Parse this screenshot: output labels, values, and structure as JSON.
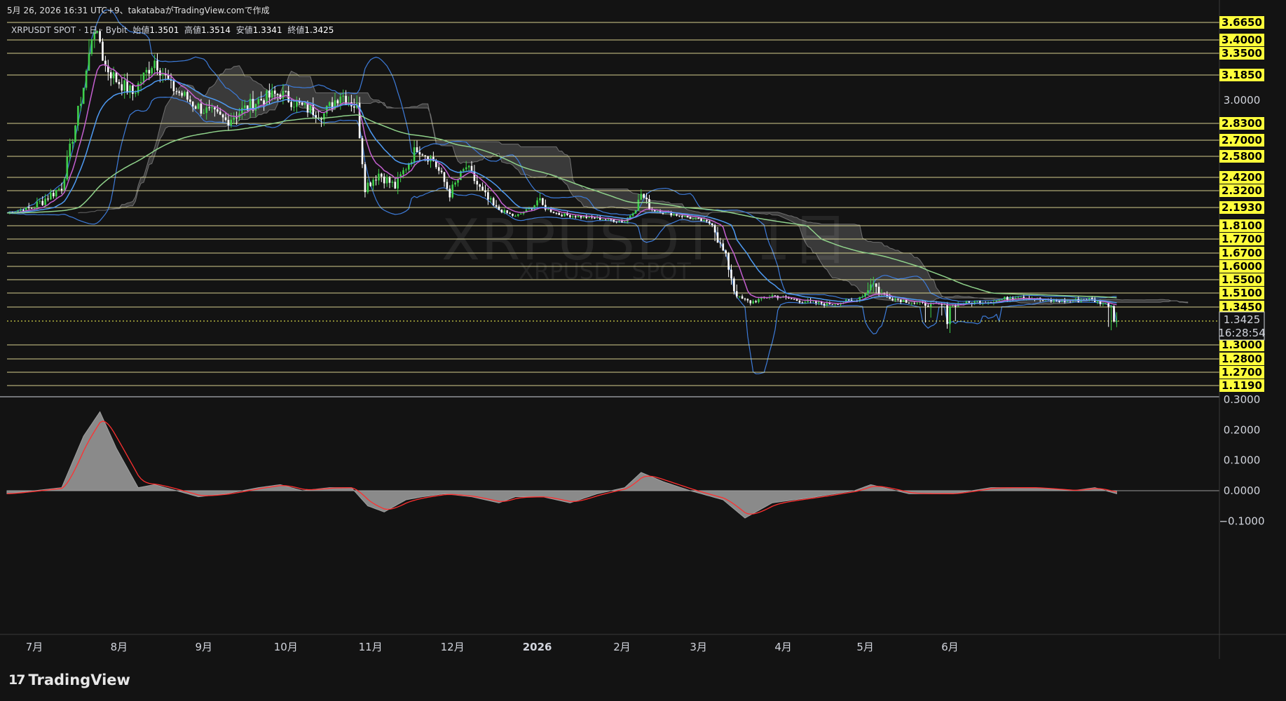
{
  "header": {
    "text": "5月 26, 2026 16:31 UTC+9、takatabaがTradingView.comで作成"
  },
  "info": {
    "symbol": "XRPUSDT SPOT · 1日 · Bybit",
    "open_label": "始値",
    "open": "1.3501",
    "high_label": "高値",
    "high": "1.3514",
    "low_label": "安値",
    "low": "1.3341",
    "close_label": "終値",
    "close": "1.3425"
  },
  "watermark": {
    "main": "XRPUSDT, 1日",
    "sub": "XRPUSDT SPOT"
  },
  "logo": {
    "mark": "17",
    "text": "TradingView"
  },
  "colors": {
    "background": "#131313",
    "level_line": "#e9e39a",
    "tag_bg": "#ffff3b",
    "up": "#3ecf4a",
    "down": "#ffffff",
    "bb": "#3d7bd9",
    "ema_fast": "#c45fd0",
    "ema_mid": "#4e9af2",
    "ema_slow": "#8fd18a",
    "macd_line": "#ff3030"
  },
  "chart_data": [
    {
      "type": "candlestick",
      "title": "XRPUSDT SPOT · 1日 · Bybit",
      "x_axis_labels": [
        "7月",
        "8月",
        "9月",
        "10月",
        "11月",
        "12月",
        "2026",
        "2月",
        "3月",
        "4月",
        "5月",
        "6月"
      ],
      "y_axis_ticks": [
        "3.0000"
      ],
      "horizontal_levels": [
        "3.6650",
        "3.4000",
        "3.3500",
        "3.1850",
        "2.8300",
        "2.7000",
        "2.5800",
        "2.4200",
        "2.3200",
        "2.1930",
        "1.8100",
        "1.7700",
        "1.6700",
        "1.6000",
        "1.5500",
        "1.5100",
        "1.3450",
        "1.3000",
        "1.2800",
        "1.2700",
        "1.1190"
      ],
      "current_price": "1.3425",
      "countdown": "16:28:54",
      "approx_close_path": [
        [
          0,
          2.08
        ],
        [
          10,
          2.2
        ],
        [
          20,
          2.35
        ],
        [
          28,
          3.1
        ],
        [
          32,
          3.55
        ],
        [
          36,
          3.25
        ],
        [
          40,
          3.15
        ],
        [
          46,
          3.05
        ],
        [
          54,
          3.3
        ],
        [
          60,
          3.1
        ],
        [
          70,
          2.95
        ],
        [
          80,
          2.85
        ],
        [
          92,
          3.0
        ],
        [
          100,
          3.05
        ],
        [
          108,
          2.95
        ],
        [
          116,
          2.9
        ],
        [
          122,
          3.05
        ],
        [
          128,
          2.95
        ],
        [
          131,
          2.35
        ],
        [
          136,
          2.45
        ],
        [
          142,
          2.35
        ],
        [
          150,
          2.65
        ],
        [
          156,
          2.55
        ],
        [
          162,
          2.3
        ],
        [
          168,
          2.5
        ],
        [
          174,
          2.3
        ],
        [
          180,
          2.15
        ],
        [
          186,
          2.0
        ],
        [
          194,
          2.25
        ],
        [
          202,
          2.05
        ],
        [
          210,
          2.0
        ],
        [
          218,
          1.95
        ],
        [
          226,
          1.9
        ],
        [
          232,
          2.3
        ],
        [
          236,
          2.15
        ],
        [
          244,
          2.05
        ],
        [
          252,
          1.95
        ],
        [
          258,
          1.85
        ],
        [
          264,
          1.6
        ],
        [
          268,
          1.45
        ],
        [
          272,
          1.4
        ],
        [
          280,
          1.48
        ],
        [
          290,
          1.42
        ],
        [
          300,
          1.38
        ],
        [
          310,
          1.42
        ],
        [
          316,
          1.55
        ],
        [
          324,
          1.45
        ],
        [
          334,
          1.38
        ],
        [
          344,
          1.36
        ],
        [
          354,
          1.4
        ],
        [
          362,
          1.42
        ],
        [
          370,
          1.48
        ],
        [
          380,
          1.42
        ],
        [
          390,
          1.42
        ],
        [
          396,
          1.44
        ],
        [
          402,
          1.38
        ],
        [
          406,
          1.3425
        ]
      ]
    },
    {
      "type": "area",
      "title": "",
      "y_axis_ticks": [
        "0.3000",
        "0.2000",
        "0.1000",
        "0.0000",
        "−0.1000"
      ],
      "ylim": [
        -0.12,
        0.3
      ],
      "approx_histogram": [
        [
          0,
          -0.01
        ],
        [
          20,
          0.01
        ],
        [
          28,
          0.18
        ],
        [
          34,
          0.26
        ],
        [
          40,
          0.14
        ],
        [
          48,
          0.01
        ],
        [
          54,
          0.02
        ],
        [
          62,
          0.0
        ],
        [
          70,
          -0.02
        ],
        [
          80,
          -0.01
        ],
        [
          92,
          0.01
        ],
        [
          100,
          0.02
        ],
        [
          108,
          0.0
        ],
        [
          118,
          0.01
        ],
        [
          126,
          0.01
        ],
        [
          132,
          -0.05
        ],
        [
          138,
          -0.07
        ],
        [
          146,
          -0.03
        ],
        [
          152,
          -0.02
        ],
        [
          160,
          -0.01
        ],
        [
          170,
          -0.02
        ],
        [
          180,
          -0.04
        ],
        [
          186,
          -0.02
        ],
        [
          196,
          -0.02
        ],
        [
          206,
          -0.04
        ],
        [
          216,
          -0.01
        ],
        [
          226,
          0.01
        ],
        [
          232,
          0.06
        ],
        [
          240,
          0.03
        ],
        [
          250,
          0.0
        ],
        [
          262,
          -0.03
        ],
        [
          270,
          -0.09
        ],
        [
          280,
          -0.04
        ],
        [
          296,
          -0.02
        ],
        [
          310,
          0.0
        ],
        [
          316,
          0.02
        ],
        [
          330,
          -0.01
        ],
        [
          346,
          -0.01
        ],
        [
          360,
          0.01
        ],
        [
          376,
          0.01
        ],
        [
          390,
          0.0
        ],
        [
          398,
          0.01
        ],
        [
          406,
          -0.01
        ]
      ]
    }
  ]
}
